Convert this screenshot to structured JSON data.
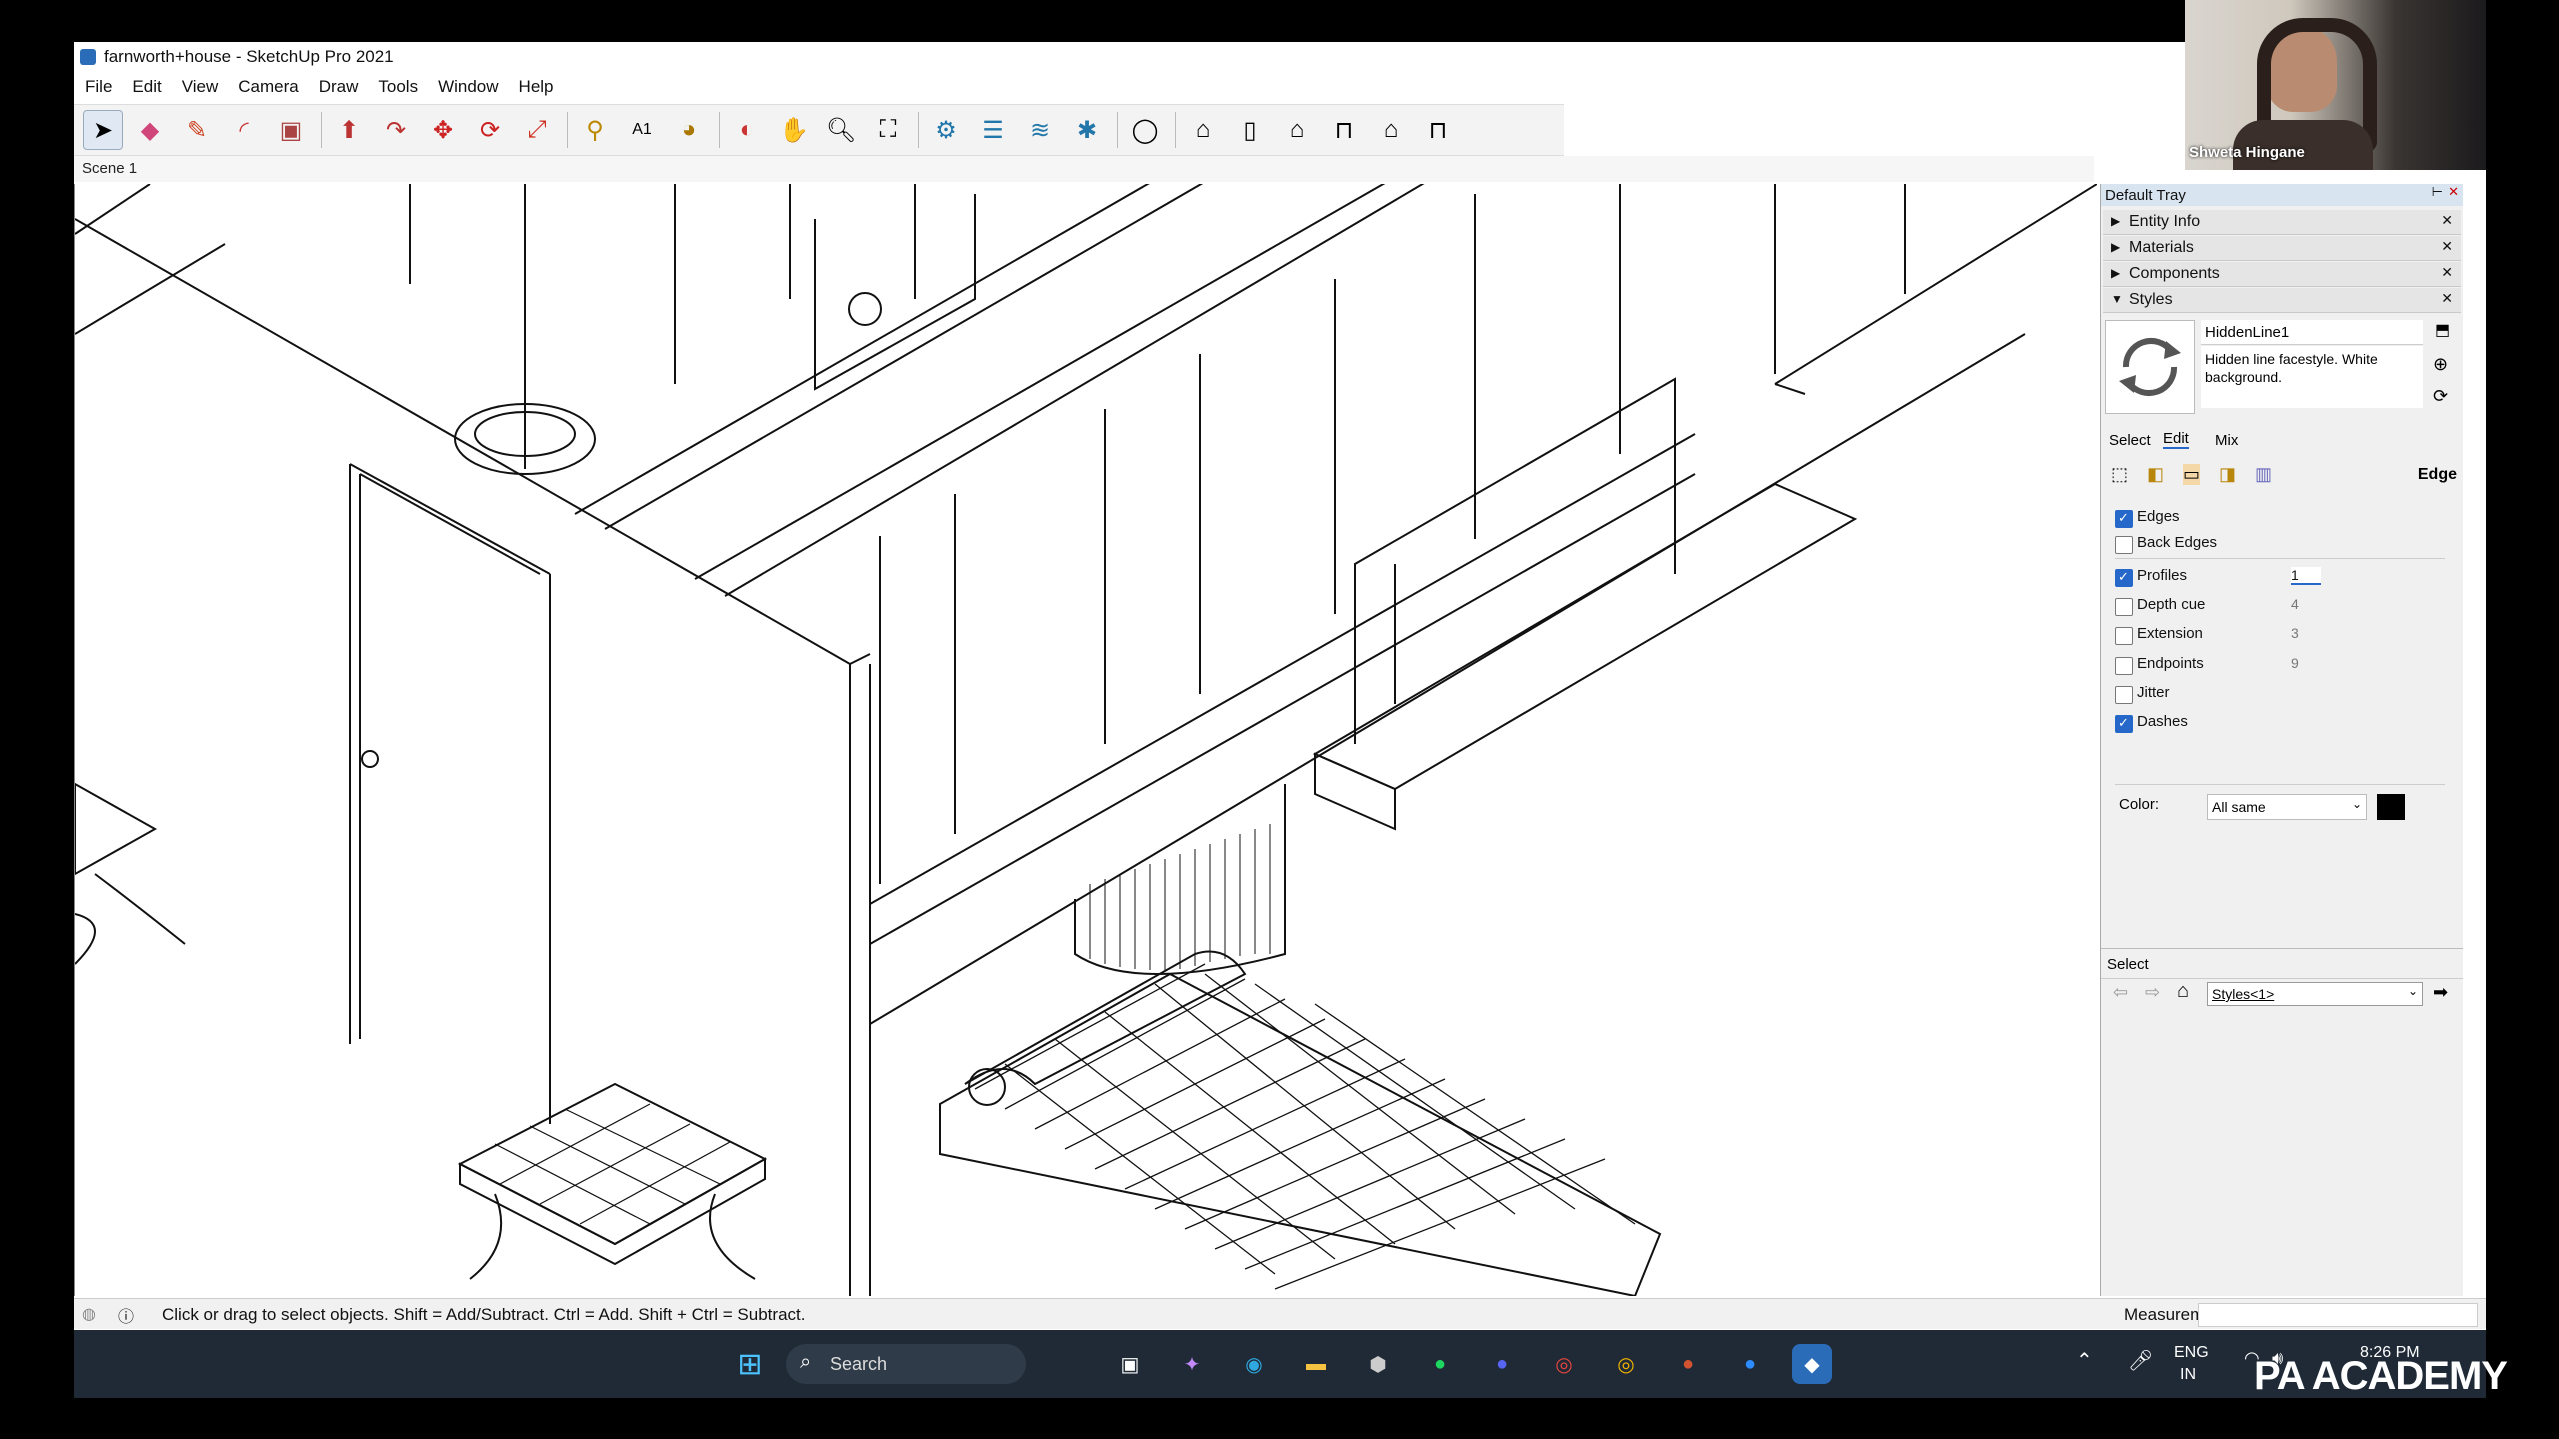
{
  "window": {
    "title": "farnworth+house - SketchUp Pro 2021"
  },
  "menu": [
    "File",
    "Edit",
    "View",
    "Camera",
    "Draw",
    "Tools",
    "Window",
    "Help"
  ],
  "toolbar": {
    "icons": [
      "select-icon",
      "eraser-icon",
      "pencil-icon",
      "arc-icon",
      "rectangle-icon",
      "push-pull-icon",
      "follow-me-icon",
      "move-icon",
      "rotate-icon",
      "scale-icon",
      "tape-measure-icon",
      "text-icon",
      "paint-bucket-icon",
      "orbit-icon",
      "pan-icon",
      "zoom-icon",
      "zoom-extents-icon",
      "section-plane-icon",
      "section-display-icon",
      "section-fill-icon",
      "section-cut-icon",
      "user-profile-icon",
      "iso-view-icon",
      "front-view-icon",
      "home-view-icon",
      "right-view-icon",
      "back-view-icon",
      "left-view-icon"
    ]
  },
  "scene": {
    "tab": "Scene 1"
  },
  "status": {
    "hint": "Click or drag to select objects. Shift = Add/Subtract. Ctrl = Add. Shift + Ctrl = Subtract.",
    "measurements_label": "Measurements"
  },
  "tray": {
    "title": "Default Tray",
    "sections": [
      "Entity Info",
      "Materials",
      "Components",
      "Styles"
    ],
    "style_name": "HiddenLine1",
    "style_desc": "Hidden line facestyle. White background.",
    "tabs": [
      "Select",
      "Edit",
      "Mix"
    ],
    "edge_heading": "Edge",
    "options": [
      {
        "label": "Edges",
        "checked": true,
        "value": ""
      },
      {
        "label": "Back Edges",
        "checked": false,
        "value": ""
      },
      {
        "label": "Profiles",
        "checked": true,
        "value": "1"
      },
      {
        "label": "Depth cue",
        "checked": false,
        "value": "4"
      },
      {
        "label": "Extension",
        "checked": false,
        "value": "3"
      },
      {
        "label": "Endpoints",
        "checked": false,
        "value": "9"
      },
      {
        "label": "Jitter",
        "checked": false,
        "value": ""
      },
      {
        "label": "Dashes",
        "checked": true,
        "value": ""
      }
    ],
    "color_label": "Color:",
    "color_value": "All same",
    "color_swatch": "#000000",
    "select_label": "Select",
    "styles_dropdown": "Styles<1>"
  },
  "taskbar": {
    "search_label": "Search",
    "lang": "ENG",
    "region": "IN",
    "time": "8:26 PM",
    "icons": [
      "windows-start-icon",
      "search-icon",
      "task-view-icon",
      "copilot-icon",
      "edge-icon",
      "file-explorer-icon",
      "obs-icon",
      "spotify-icon",
      "discord-icon",
      "chrome-icon",
      "chrome-canary-icon",
      "powerpoint-icon",
      "zoom-icon",
      "sketchup-icon"
    ]
  },
  "video": {
    "participant": "Shweta Hingane"
  },
  "watermark": "PA ACADEMY",
  "colors": {
    "accent": "#2568c9",
    "taskbar": "#1f2a36",
    "tray_header": "#d8e4f0"
  }
}
